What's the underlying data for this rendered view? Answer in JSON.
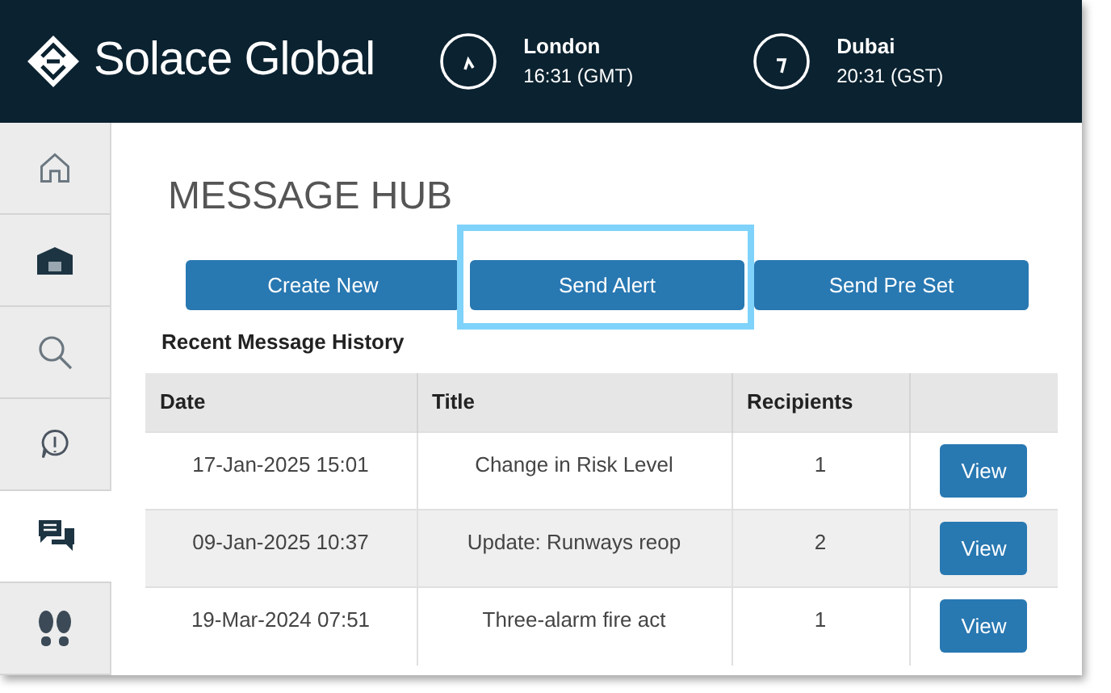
{
  "header": {
    "brand": "Solace Global",
    "clocks": [
      {
        "city": "London",
        "time": "16:31 (GMT)"
      },
      {
        "city": "Dubai",
        "time": "20:31 (GST)"
      }
    ]
  },
  "sidebar": {
    "items": [
      {
        "kind": "home",
        "selected": false
      },
      {
        "kind": "building",
        "selected": false
      },
      {
        "kind": "search",
        "selected": false
      },
      {
        "kind": "alert",
        "selected": false
      },
      {
        "kind": "messages",
        "selected": true
      },
      {
        "kind": "footsteps",
        "selected": false
      }
    ]
  },
  "page": {
    "title": "MESSAGE HUB",
    "buttons": [
      {
        "label": "Create New",
        "highlighted": false
      },
      {
        "label": "Send Alert",
        "highlighted": true
      },
      {
        "label": "Send Pre Set",
        "highlighted": false
      }
    ],
    "section_title": "Recent Message History",
    "table": {
      "columns": [
        "Date",
        "Title",
        "Recipients"
      ],
      "rows": [
        {
          "date": "17-Jan-2025 15:01",
          "title": "Change in Risk Level",
          "recipients": "1",
          "action": "View"
        },
        {
          "date": "09-Jan-2025 10:37",
          "title": "Update: Runways reop",
          "recipients": "2",
          "action": "View"
        },
        {
          "date": "19-Mar-2024 07:51",
          "title": "Three-alarm fire act",
          "recipients": "1",
          "action": "View"
        }
      ]
    }
  }
}
